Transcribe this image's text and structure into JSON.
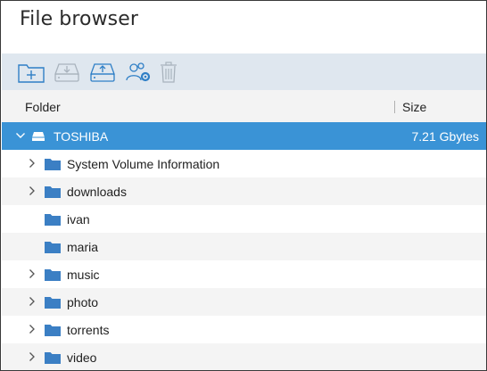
{
  "window": {
    "title": "File browser"
  },
  "toolbar": {
    "buttons": [
      {
        "icon": "new-folder-icon"
      },
      {
        "icon": "download-icon"
      },
      {
        "icon": "upload-icon"
      },
      {
        "icon": "share-users-icon"
      },
      {
        "icon": "trash-icon"
      }
    ]
  },
  "columns": {
    "folder": "Folder",
    "size": "Size"
  },
  "tree": {
    "root": {
      "label": "TOSHIBA",
      "size": "7.21 Gbytes",
      "expanded": true,
      "icon": "drive-icon"
    },
    "folders": [
      {
        "label": "System Volume Information",
        "expandable": true
      },
      {
        "label": "downloads",
        "expandable": true
      },
      {
        "label": "ivan",
        "expandable": false
      },
      {
        "label": "maria",
        "expandable": false
      },
      {
        "label": "music",
        "expandable": true
      },
      {
        "label": "photo",
        "expandable": true
      },
      {
        "label": "torrents",
        "expandable": true
      },
      {
        "label": "video",
        "expandable": true
      }
    ]
  },
  "colors": {
    "selected": "#3a93d6",
    "folder": "#3b7fc4",
    "toolbar": "#dfe7ef"
  }
}
